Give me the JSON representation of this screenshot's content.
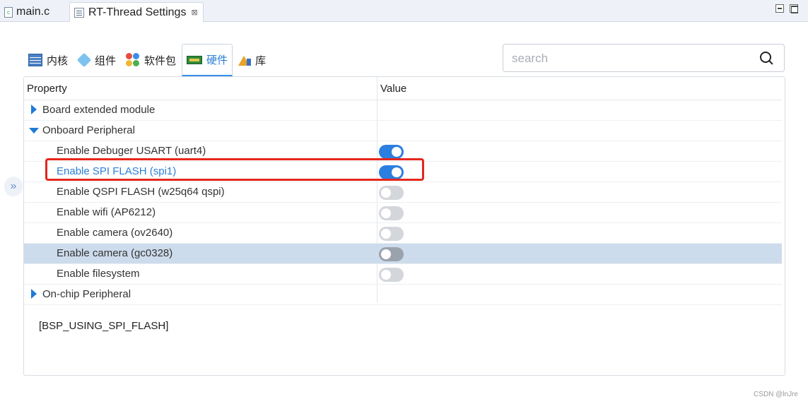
{
  "editor_tabs": [
    {
      "label": "main.c"
    },
    {
      "label": "RT-Thread Settings",
      "close": "⊠"
    }
  ],
  "category_tabs": [
    {
      "label": "内核",
      "icon": "kernel-table-icon"
    },
    {
      "label": "组件",
      "icon": "component-cube-icon"
    },
    {
      "label": "软件包",
      "icon": "package-icon"
    },
    {
      "label": "硬件",
      "icon": "hardware-board-icon",
      "active": true
    },
    {
      "label": "库",
      "icon": "library-icon"
    }
  ],
  "search": {
    "placeholder": "search",
    "value": ""
  },
  "table": {
    "headers": {
      "property": "Property",
      "value": "Value"
    },
    "rows": [
      {
        "label": "Board extended module",
        "level": 0,
        "expanded": false
      },
      {
        "label": "Onboard Peripheral",
        "level": 0,
        "expanded": true
      },
      {
        "label": "Enable Debuger USART (uart4)",
        "level": 1,
        "enabled": true
      },
      {
        "label": "Enable SPI FLASH (spi1)",
        "level": 1,
        "enabled": true
      },
      {
        "label": "Enable QSPI FLASH (w25q64 qspi)",
        "level": 1,
        "enabled": false
      },
      {
        "label": "Enable wifi (AP6212)",
        "level": 1,
        "enabled": false
      },
      {
        "label": "Enable camera (ov2640)",
        "level": 1,
        "enabled": false
      },
      {
        "label": "Enable camera (gc0328)",
        "level": 1,
        "enabled": false,
        "selected": true
      },
      {
        "label": "Enable filesystem",
        "level": 1,
        "enabled": false
      },
      {
        "label": "On-chip Peripheral",
        "level": 0,
        "expanded": false
      }
    ]
  },
  "description": "[BSP_USING_SPI_FLASH]",
  "collapse_glyph": "»",
  "watermark": "CSDN @lnJre",
  "colors": {
    "accent": "#2b7fe0",
    "highlight": "#e5271b",
    "selected_row": "#cddcec"
  }
}
